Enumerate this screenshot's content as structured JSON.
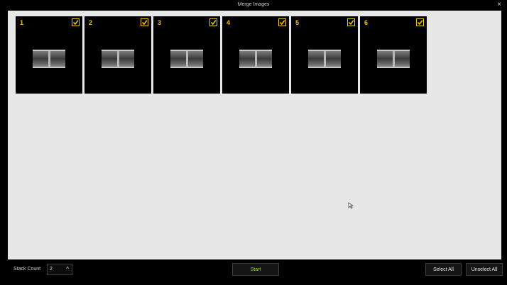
{
  "window": {
    "title": "Merge Images",
    "close_glyph": "×"
  },
  "thumbnails": [
    {
      "number": "1",
      "checked": true
    },
    {
      "number": "2",
      "checked": true
    },
    {
      "number": "3",
      "checked": true
    },
    {
      "number": "4",
      "checked": true
    },
    {
      "number": "5",
      "checked": true
    },
    {
      "number": "6",
      "checked": true
    }
  ],
  "footer": {
    "stack_count_label": "Stack Count",
    "stack_count_value": "2",
    "stepper_glyph": "^",
    "start_label": "Start",
    "select_all_label": "Select All",
    "unselect_all_label": "Unselect All"
  },
  "colors": {
    "accent": "#f0c419",
    "start_text": "#9ddc3c",
    "panel_bg": "#e7e7e7",
    "chrome_bg": "#000000"
  }
}
